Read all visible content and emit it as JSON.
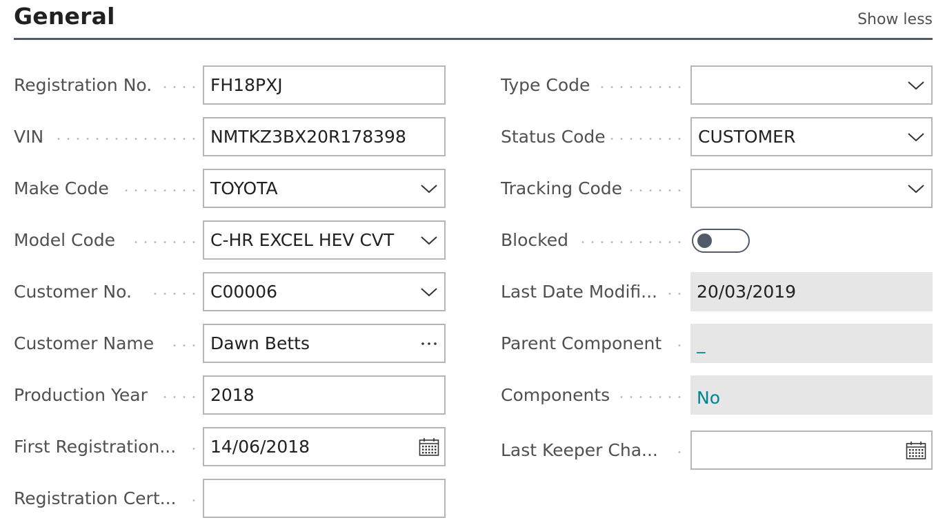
{
  "header": {
    "title": "General",
    "show_less": "Show less"
  },
  "left_fields": [
    {
      "label": "Registration No.",
      "value": "FH18PXJ",
      "control": "text"
    },
    {
      "label": "VIN",
      "value": "NMTKZ3BX20R178398",
      "control": "text"
    },
    {
      "label": "Make Code",
      "value": "TOYOTA",
      "control": "dropdown"
    },
    {
      "label": "Model Code",
      "value": "C-HR EXCEL HEV CVT",
      "control": "dropdown"
    },
    {
      "label": "Customer No.",
      "value": "C00006",
      "control": "dropdown"
    },
    {
      "label": "Customer Name",
      "value": "Dawn Betts",
      "control": "lookup"
    },
    {
      "label": "Production Year",
      "value": "2018",
      "control": "text"
    },
    {
      "label": "First Registration...",
      "value": "14/06/2018",
      "control": "date"
    },
    {
      "label": "Registration Cert...",
      "value": "",
      "control": "text"
    }
  ],
  "right_fields": [
    {
      "label": "Type Code",
      "value": "",
      "control": "dropdown"
    },
    {
      "label": "Status Code",
      "value": "CUSTOMER",
      "control": "dropdown"
    },
    {
      "label": "Tracking Code",
      "value": "",
      "control": "dropdown"
    },
    {
      "label": "Blocked",
      "value": "off",
      "control": "toggle"
    },
    {
      "label": "Last Date Modifi...",
      "value": "20/03/2019",
      "control": "readonly"
    },
    {
      "label": "Parent Component",
      "value": "_",
      "control": "readonly-link"
    },
    {
      "label": "Components",
      "value": "No",
      "control": "readonly-link"
    },
    {
      "label": "Last Keeper Cha...",
      "value": "",
      "control": "date"
    }
  ],
  "icons": {
    "dropdown": "chevron-down-icon",
    "lookup": "ellipsis-icon",
    "date": "calendar-icon"
  },
  "colors": {
    "accent": "#00838f",
    "header_rule": "#505a69",
    "readonly_bg": "#e6e6e6",
    "field_border": "#b5b5b5"
  }
}
